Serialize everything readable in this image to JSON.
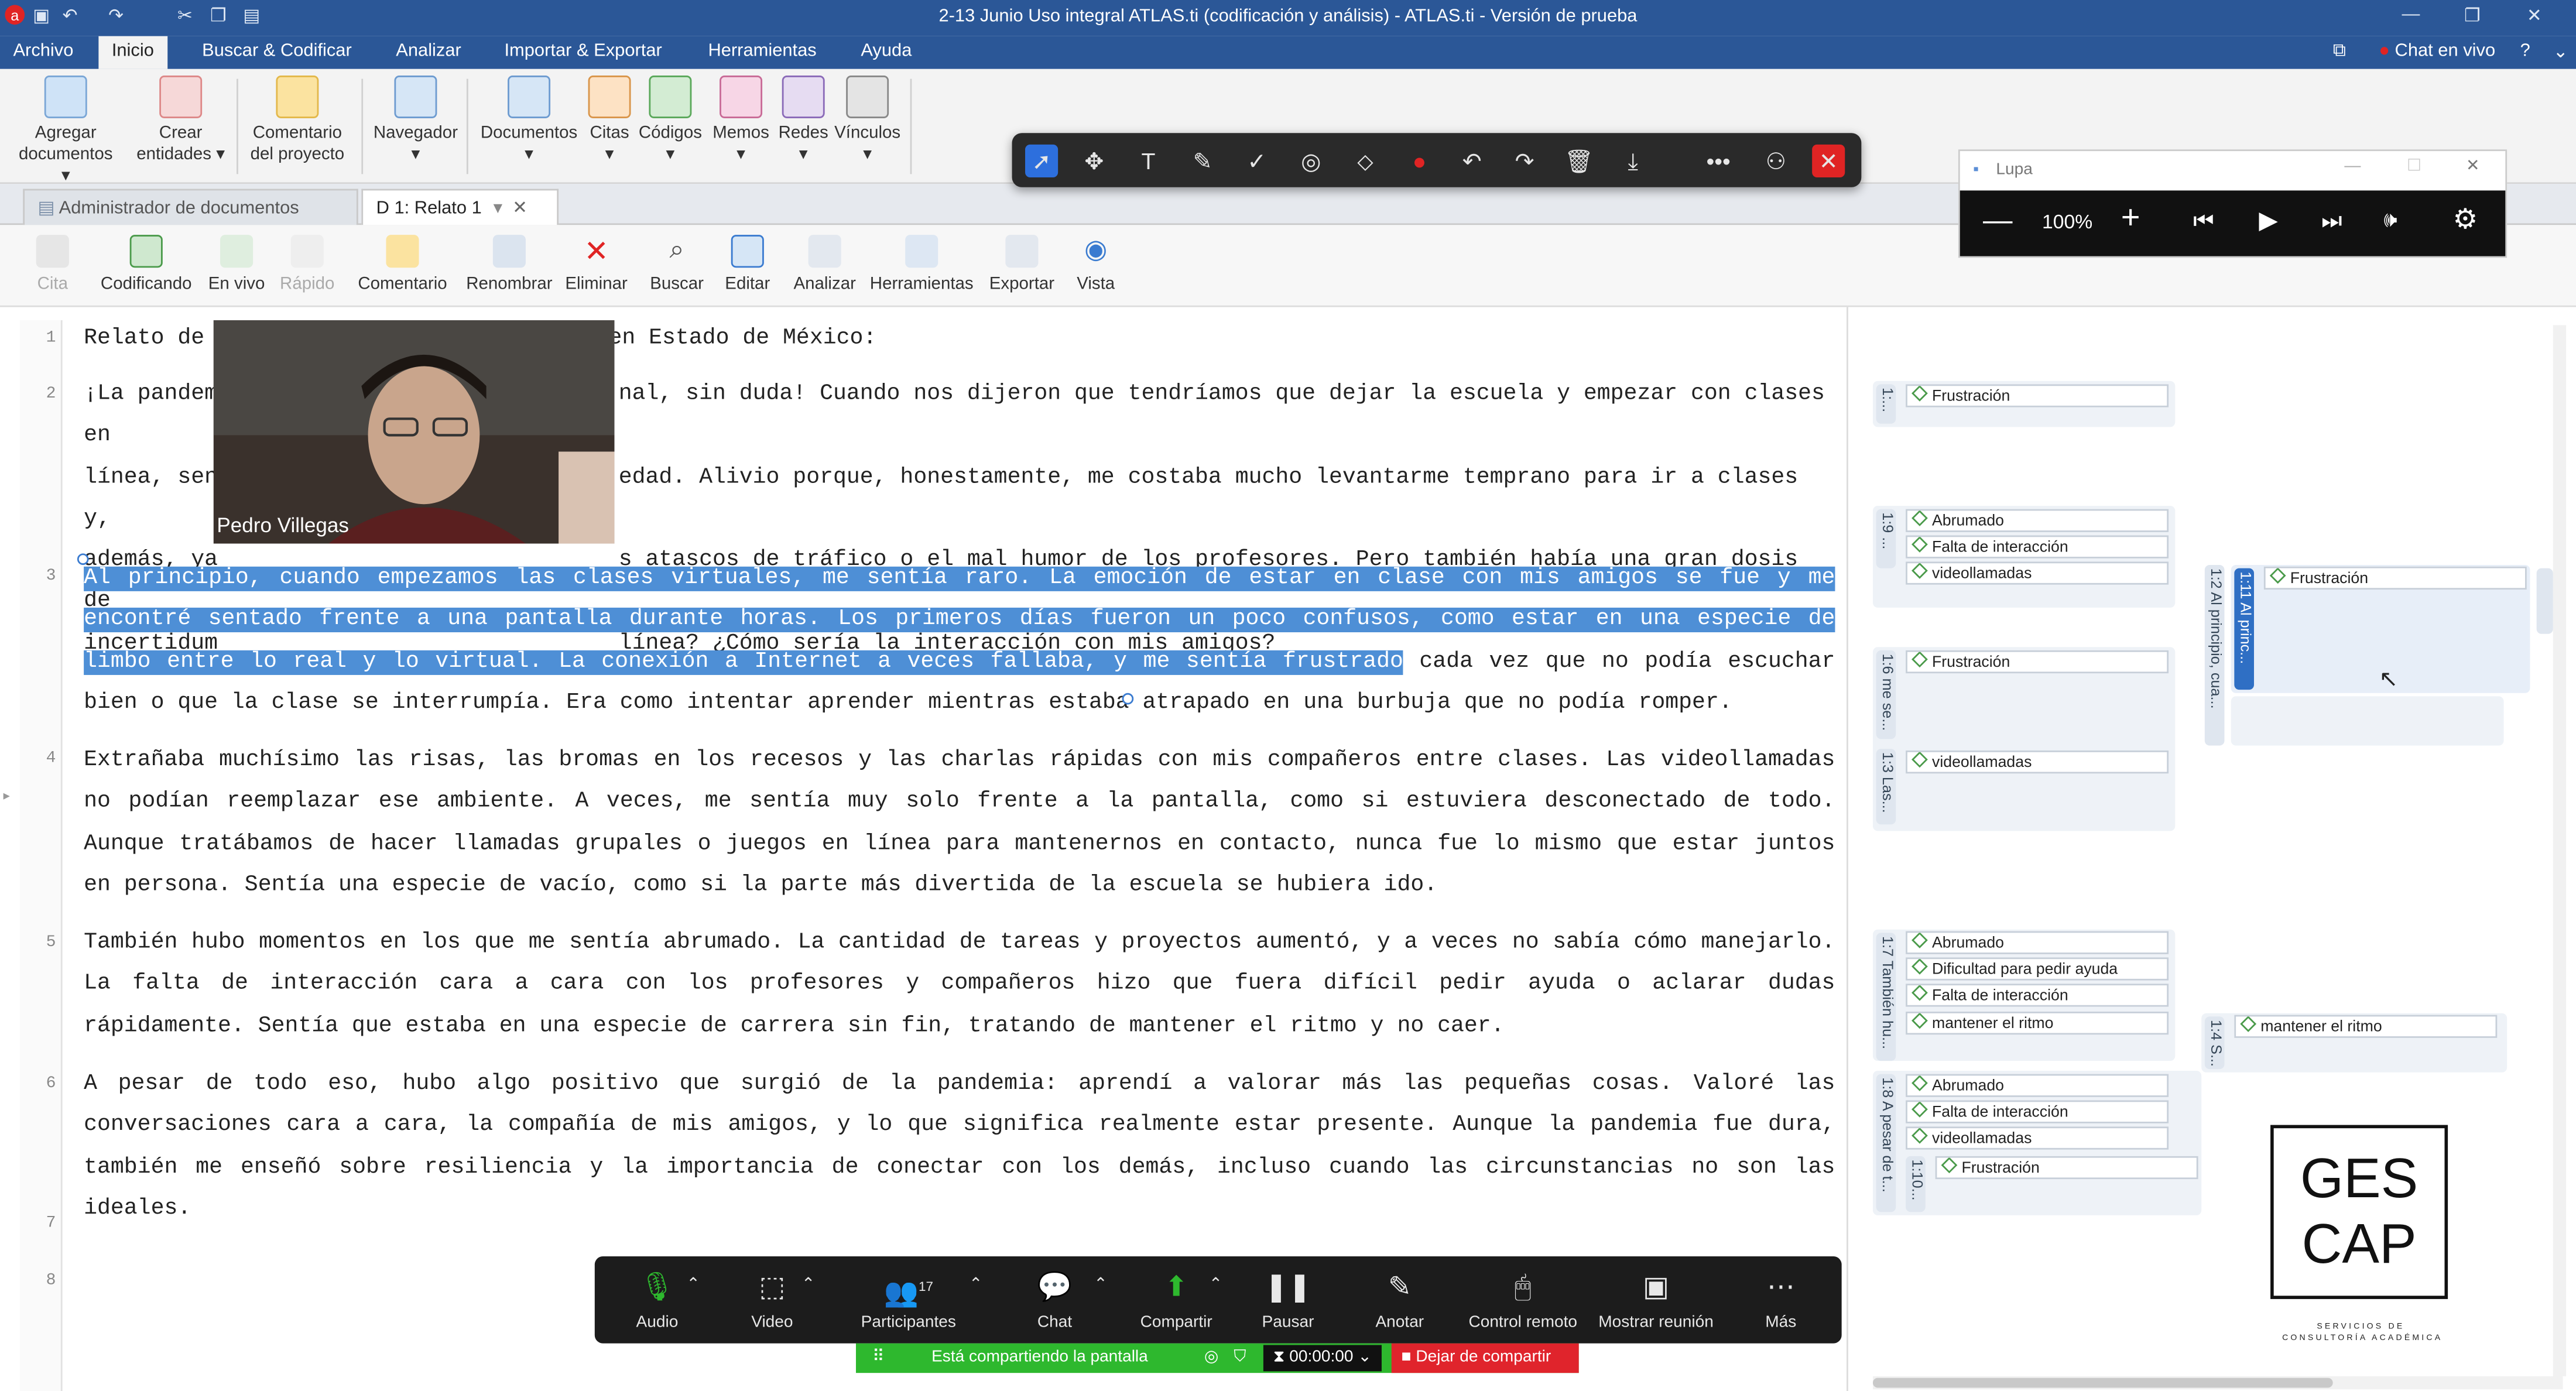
{
  "window": {
    "title": "2-13 Junio Uso integral ATLAS.ti (codificación y análisis) - ATLAS.ti - Versión de prueba",
    "chat_label": "Chat en vivo"
  },
  "menu": [
    "Archivo",
    "Inicio",
    "Buscar & Codificar",
    "Analizar",
    "Importar & Exportar",
    "Herramientas",
    "Ayuda"
  ],
  "ribbon": {
    "add_documents": [
      "Agregar",
      "documentos"
    ],
    "create_entities": [
      "Crear",
      "entidades"
    ],
    "project_comment": [
      "Comentario",
      "del proyecto"
    ],
    "navigator": "Navegador",
    "documents": "Documentos",
    "quotes": "Citas",
    "codes": "Códigos",
    "memos": "Memos",
    "networks": "Redes",
    "links": "Vínculos"
  },
  "doc_tabs": [
    "Administrador de documentos",
    "D 1: Relato 1"
  ],
  "doc_toolbar": [
    "Cita",
    "Codificando",
    "En vivo",
    "Rápido",
    "Comentario",
    "Renombrar",
    "Eliminar",
    "Buscar",
    "Editar",
    "Analizar",
    "Herramientas",
    "Exportar",
    "Vista"
  ],
  "document": {
    "line_numbers": [
      "1",
      "2",
      "3",
      "4",
      "5",
      "6",
      "7",
      "8"
    ],
    "p1": {
      "pre": "Relato de",
      "post": "en Estado de México:"
    },
    "p2": [
      {
        "pre": "¡La pandem",
        "post": "nal, sin duda! Cuando nos dijeron que tendríamos que dejar la escuela y empezar con clases en"
      },
      {
        "pre": "línea, sen",
        "post": "edad. Alivio porque, honestamente, me costaba mucho levantarme temprano para ir a clases y,"
      },
      {
        "pre": "además, ya",
        "post": "s atascos de tráfico o el mal humor de los profesores. Pero también había una gran dosis de"
      },
      {
        "pre": "incertidum",
        "post": "línea? ¿Cómo sería la interacción con mis amigos?"
      }
    ],
    "p3_highlight": "Al principio, cuando empezamos las clases virtuales, me sentía raro. La emoción de estar en clase con mis amigos se fue y me encontré sentado frente a una pantalla durante horas. Los primeros días fueron un poco confusos, como estar en una especie de limbo entre lo real y lo virtual. La conexión a Internet a veces fallaba, y me sentía frustrado",
    "p3_rest": " cada vez que no podía escuchar bien o que la clase se interrumpía. Era como intentar aprender mientras estaba atrapado en una burbuja que no podía romper.",
    "p4": "Extrañaba muchísimo las risas, las bromas en los recesos y las charlas rápidas con mis compañeros entre clases. Las videollamadas no podían reemplazar ese ambiente. A veces, me sentía muy solo frente a la pantalla, como si estuviera desconectado de todo. Aunque tratábamos de hacer llamadas grupales o juegos en línea para mantenernos en contacto, nunca fue lo mismo que estar juntos en persona. Sentía una especie de vacío, como si la parte más divertida de la escuela se hubiera ido.",
    "p5": "También hubo momentos en los que me sentía abrumado. La cantidad de tareas y proyectos aumentó, y a veces no sabía cómo manejarlo. La falta de interacción cara a cara con los profesores y compañeros hizo que fuera difícil pedir ayuda o aclarar dudas rápidamente. Sentía que estaba en una especie de carrera sin fin, tratando de mantener el ritmo y no caer.",
    "p6": "A pesar de todo eso, hubo algo positivo que surgió de la pandemia: aprendí a valorar más las pequeñas cosas. Valoré las conversaciones cara a cara, la compañía de mis amigos, y lo que significa realmente estar presente. Aunque la pandemia fue dura, también me enseñó sobre resiliencia y la importancia de conectar con los demás, incluso cuando las circunstancias no son las ideales."
  },
  "margin": {
    "q1": {
      "label": "1:...",
      "codes": [
        "Frustración"
      ]
    },
    "q2": {
      "label": "1:9 ...",
      "codes": [
        "Abrumado",
        "Falta de interacción",
        "videollamadas"
      ]
    },
    "q3": {
      "label": "1:6 me se...",
      "codes": [
        "Frustración"
      ]
    },
    "q4": {
      "label": "1:3 Las...",
      "codes": [
        "videollamadas"
      ]
    },
    "q5": {
      "label": "1:2 Al principio, cua...",
      "codes": []
    },
    "q6": {
      "label": "1:11 Al princ...",
      "codes": [
        "Frustración"
      ]
    },
    "q7": {
      "label": "1:7 También hu...",
      "codes": [
        "Abrumado",
        "Dificultad para pedir ayuda",
        "Falta de interacción",
        "mantener el ritmo"
      ]
    },
    "q8": {
      "label": "1:4 S...",
      "codes": [
        "mantener el ritmo"
      ]
    },
    "q9": {
      "label": "1:8 A pesar de t...",
      "codes": [
        "Abrumado",
        "Falta de interacción",
        "videollamadas"
      ]
    },
    "q10": {
      "label": "1:10...",
      "codes": [
        "Frustración"
      ]
    }
  },
  "lupa": {
    "title": "Lupa",
    "zoom": "100%"
  },
  "video": {
    "name": "Pedro Villegas"
  },
  "zoom_bar": {
    "items": [
      "Audio",
      "Video",
      "Participantes",
      "Chat",
      "Compartir",
      "Pausar",
      "Anotar",
      "Control remoto",
      "Mostrar reunión",
      "Más"
    ],
    "participants_count": "17",
    "sharing_text": "Está compartiendo la pantalla",
    "timer": "00:00:00",
    "stop_share": "Dejar de compartir"
  },
  "logo": {
    "line1": "GES",
    "line2": "CAP",
    "tagline1": "SERVICIOS DE",
    "tagline2": "CONSULTORÍA ACADÉMICA"
  },
  "colors": {
    "accent": "#2b5797",
    "highlight": "#4e8fd6",
    "zoom_green": "#2eb82e",
    "stop_red": "#e0242c"
  }
}
